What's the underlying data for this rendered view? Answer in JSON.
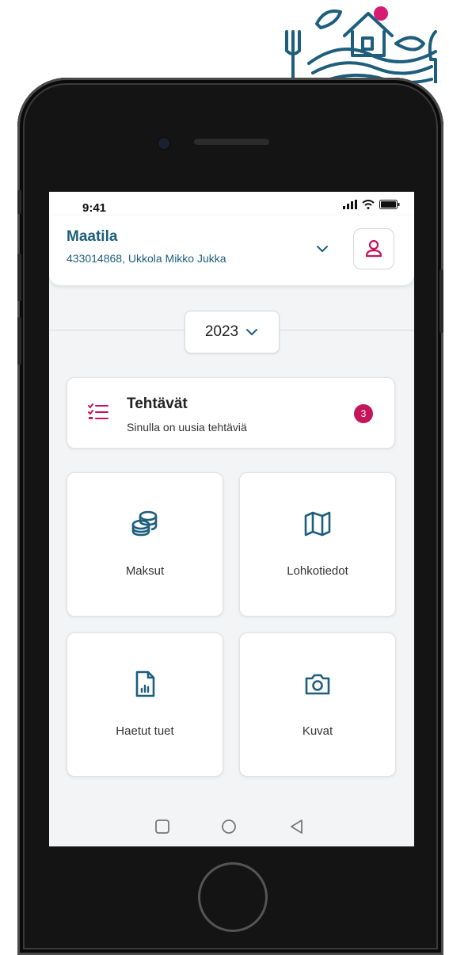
{
  "colors": {
    "primary": "#1d5e7c",
    "accent": "#c4165a",
    "screen_bg": "#f3f4f6"
  },
  "status_bar": {
    "time": "9:41",
    "icons": [
      "signal-icon",
      "wifi-icon",
      "battery-icon"
    ]
  },
  "header": {
    "title": "Maatila",
    "subtitle": "433014868, Ukkola Mikko Jukka",
    "expand_icon": "chevron-down-icon",
    "profile_icon": "user-icon"
  },
  "year_selector": {
    "value": "2023",
    "icon": "chevron-down-icon"
  },
  "tasks": {
    "title": "Tehtävät",
    "subtitle": "Sinulla on uusia tehtäviä",
    "badge_count": "3",
    "icon": "task-list-icon"
  },
  "tiles": [
    {
      "label": "Maksut",
      "icon": "coins-icon"
    },
    {
      "label": "Lohkotiedot",
      "icon": "map-icon"
    },
    {
      "label": "Haetut tuet",
      "icon": "document-chart-icon"
    },
    {
      "label": "Kuvat",
      "icon": "camera-icon"
    }
  ],
  "nav_bar": {
    "icons": [
      "recent-apps-icon",
      "home-icon",
      "back-icon"
    ]
  }
}
